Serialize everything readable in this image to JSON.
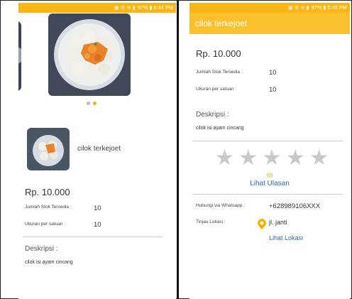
{
  "left": {
    "status_time": "6:44 PM",
    "status_battery": "97%",
    "thumb_name": "cilok terkejoet",
    "price": "Rp. 10.000",
    "stock_label": "Jumlah Stok Tersedia :",
    "stock_value": "10",
    "unit_label": "Ukuran per satuan :",
    "unit_value": "10",
    "desc_title": "Deskripsi :",
    "desc_text": "cilok isi ayam cincang"
  },
  "right": {
    "status_time": "6:45 PM",
    "status_battery": "97%",
    "title": "cilok terkejoet",
    "price": "Rp. 10.000",
    "stock_label": "Jumlah Stok Tersedia :",
    "stock_value": "10",
    "unit_label": "Ukuran per satuan :",
    "unit_value": "10",
    "desc_title": "Deskripsi :",
    "desc_text": "cilok isi ayam cincang",
    "rating_count": "(0)",
    "reviews_link": "Lihat Ulasan",
    "wa_label": "Hubungi via Whatsapp :",
    "wa_value": "+628989106XXX",
    "loc_label": "Tinjau Lokasi :",
    "loc_value": "jl. janti",
    "loc_link": "Lihat Lokasi"
  },
  "rating": {
    "value": 0,
    "max": 5
  },
  "colors": {
    "accent": "#fbc02d",
    "status_bar": "#f9b616",
    "link": "#2a68b8",
    "pin": "#f5b400",
    "star_empty": "#c8c8c8"
  }
}
